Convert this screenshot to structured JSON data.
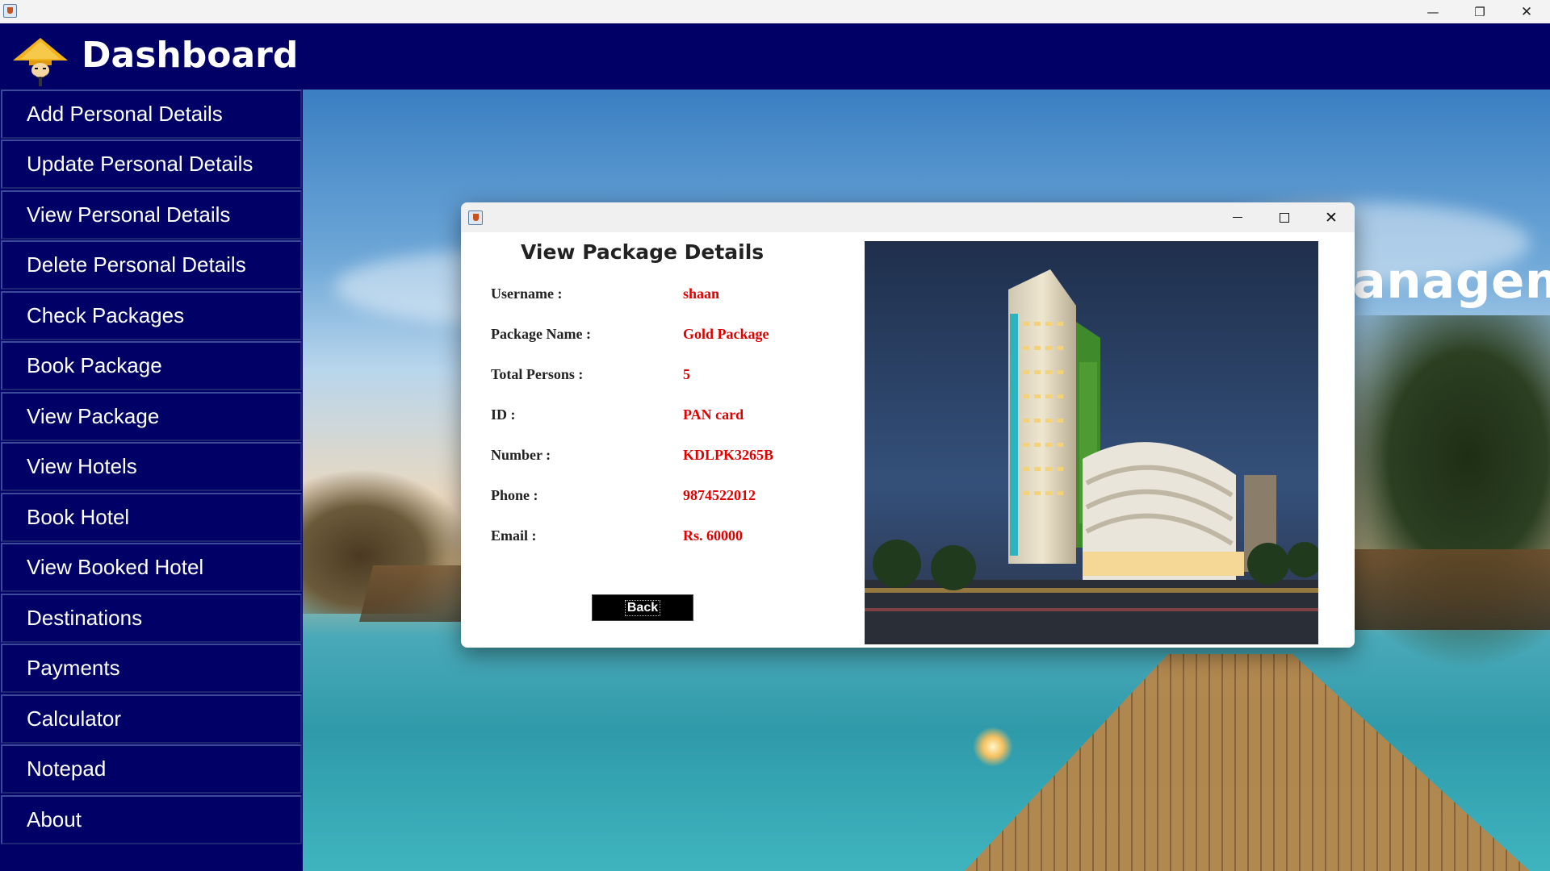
{
  "os_window": {
    "minimize_glyph": "—",
    "maximize_glyph": "❐",
    "close_glyph": "✕"
  },
  "header": {
    "title": "Dashboard",
    "logo_icon": "traveler-hat-icon"
  },
  "sidebar": {
    "items": [
      {
        "label": "Add Personal Details"
      },
      {
        "label": "Update Personal Details"
      },
      {
        "label": "View Personal Details"
      },
      {
        "label": "Delete Personal Details"
      },
      {
        "label": "Check Packages"
      },
      {
        "label": "Book Package"
      },
      {
        "label": "View Package"
      },
      {
        "label": "View Hotels"
      },
      {
        "label": "Book Hotel"
      },
      {
        "label": "View Booked Hotel"
      },
      {
        "label": "Destinations"
      },
      {
        "label": "Payments"
      },
      {
        "label": "Calculator"
      },
      {
        "label": "Notepad"
      },
      {
        "label": "About"
      }
    ]
  },
  "background": {
    "title": "Travel and Tourism Management System"
  },
  "dialog": {
    "heading": "View Package Details",
    "fields": [
      {
        "label": "Username :",
        "value": "shaan"
      },
      {
        "label": "Package Name :",
        "value": "Gold Package"
      },
      {
        "label": "Total Persons :",
        "value": "5"
      },
      {
        "label": "ID :",
        "value": "PAN card"
      },
      {
        "label": "Number :",
        "value": "KDLPK3265B"
      },
      {
        "label": "Phone :",
        "value": "9874522012"
      },
      {
        "label": "Email :",
        "value": "Rs. 60000"
      }
    ],
    "back_label": "Back",
    "colors": {
      "value_text": "#e00000",
      "label_text": "#222222"
    }
  },
  "colors": {
    "header_bg": "#000066",
    "sidebar_bg": "#000066",
    "sidebar_text": "#ffffff"
  }
}
